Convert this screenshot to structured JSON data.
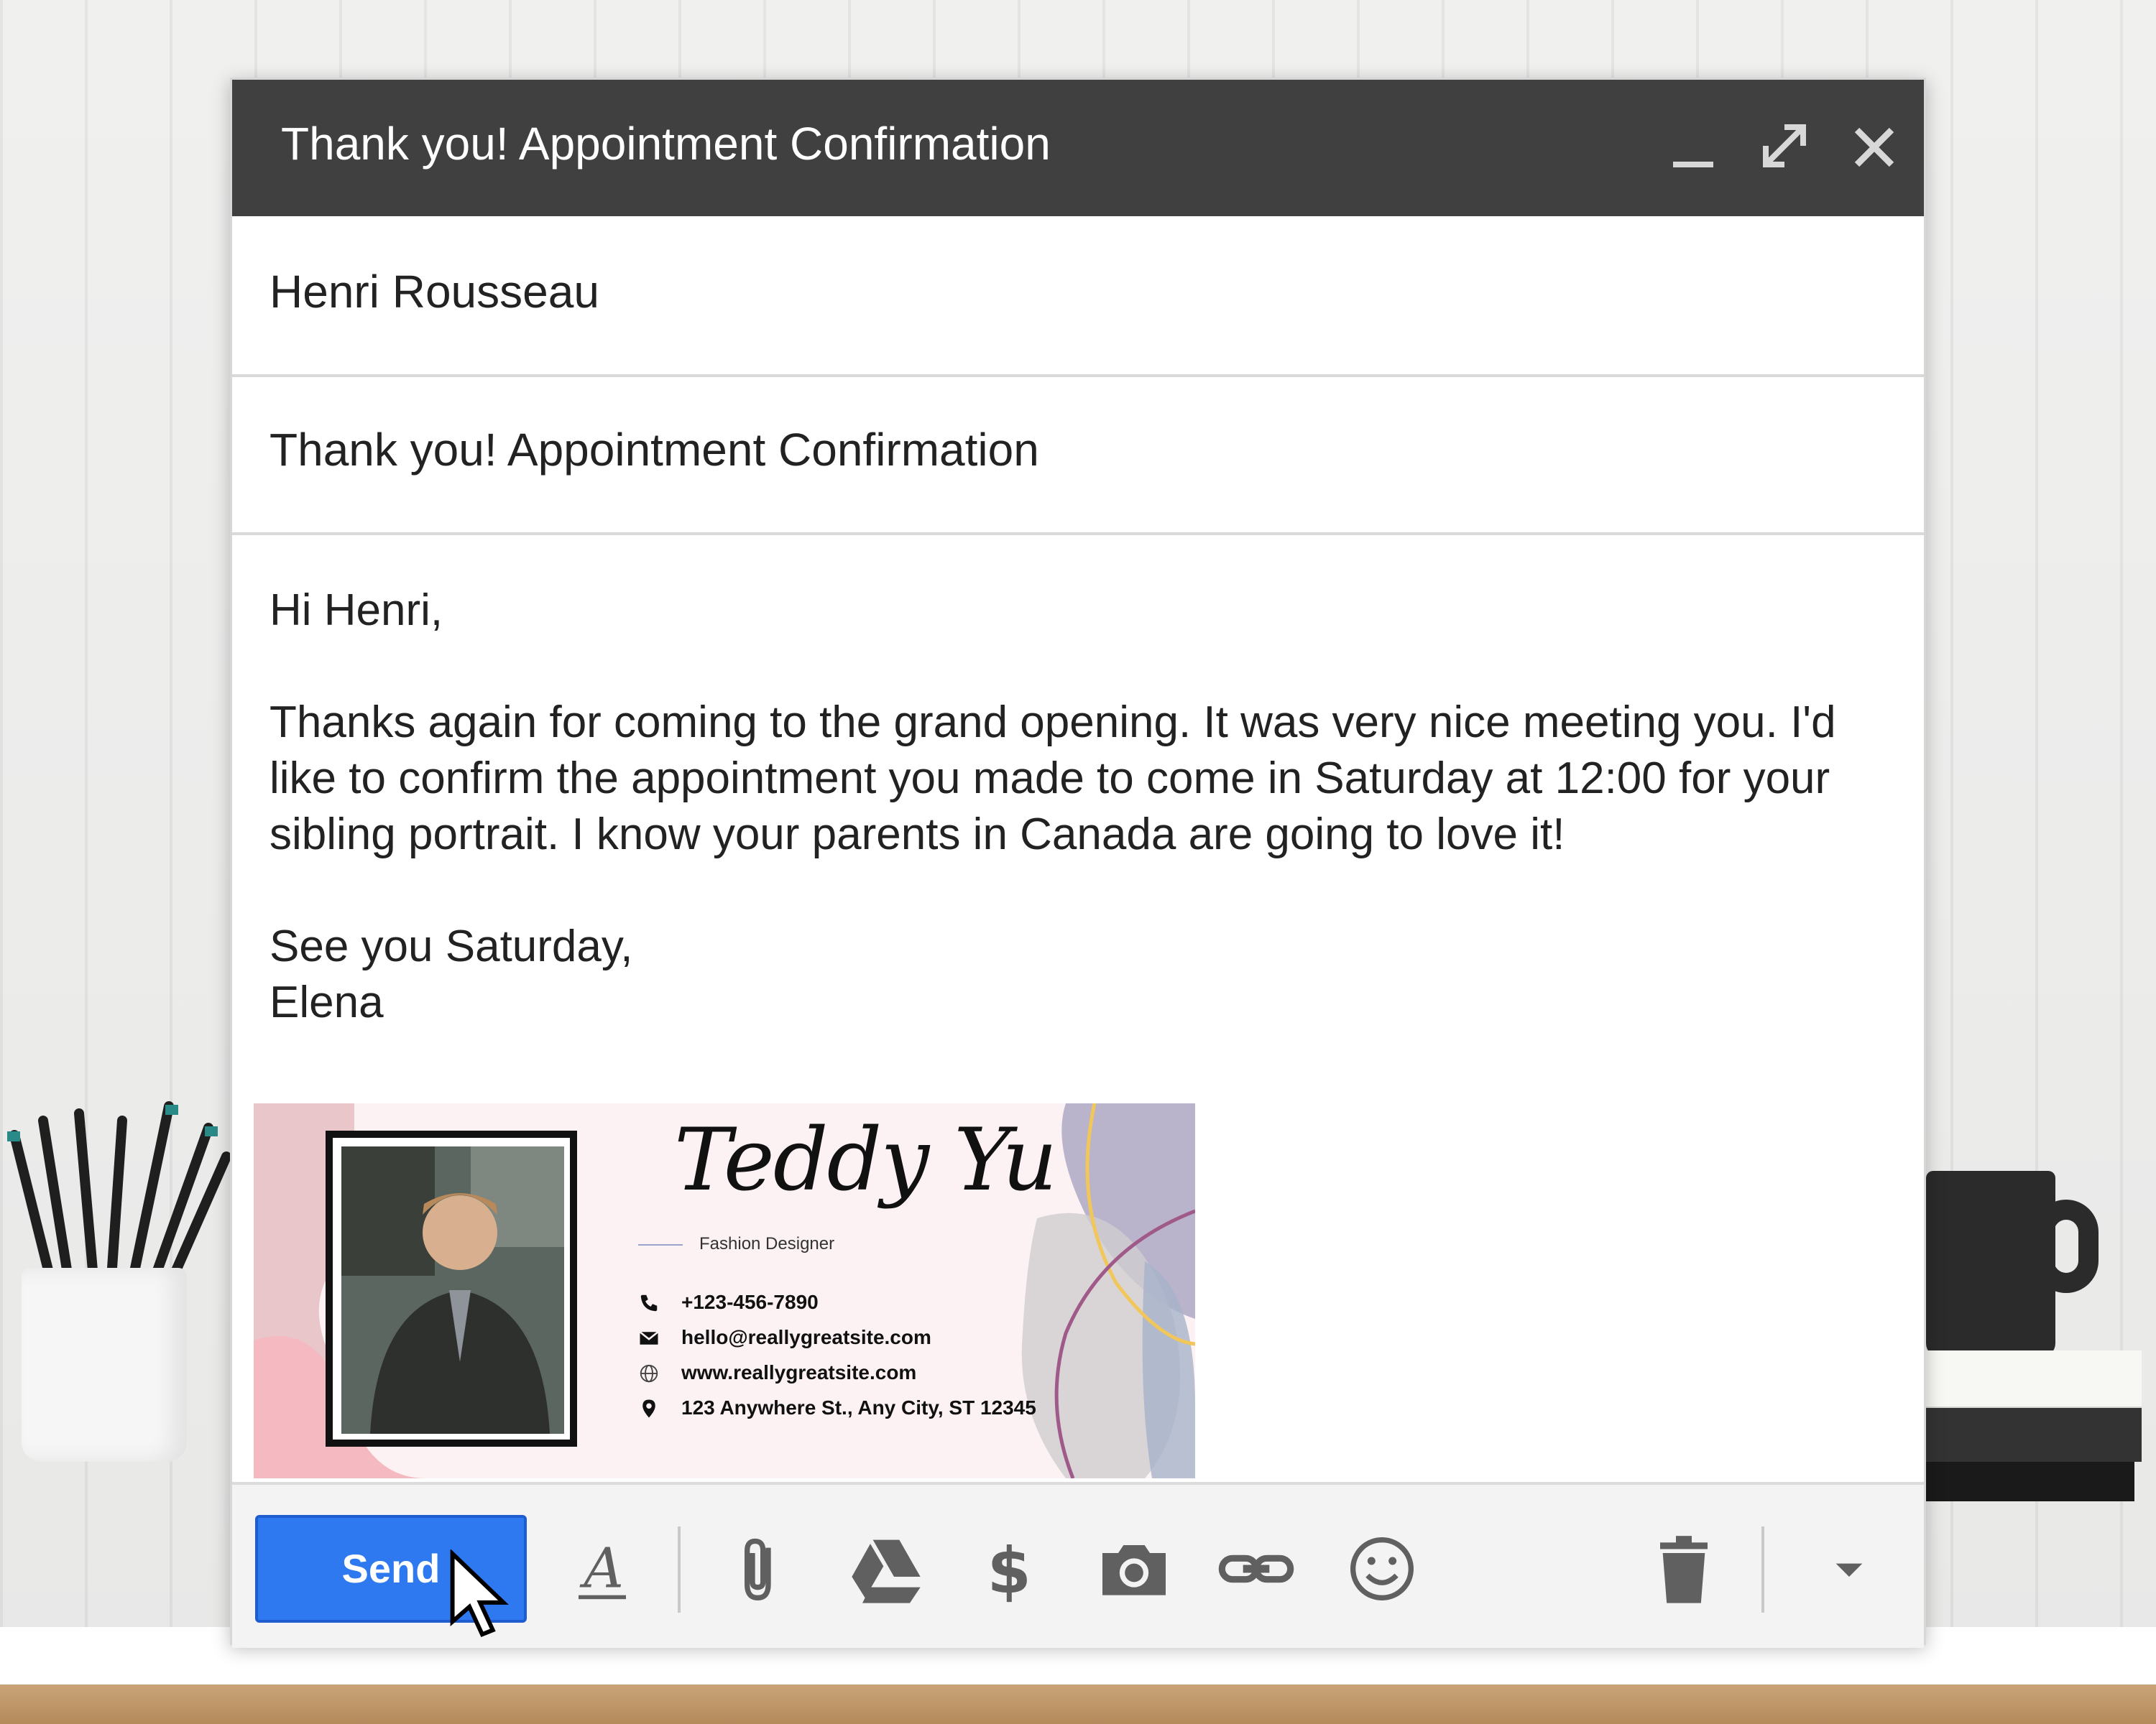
{
  "window": {
    "title": "Thank you! Appointment Confirmation",
    "controls": {
      "minimize": "minimize-icon",
      "expand": "expand-icon",
      "close": "close-icon"
    }
  },
  "compose": {
    "to": "Henri Rousseau",
    "subject": "Thank you! Appointment Confirmation",
    "body": {
      "greeting": "Hi Henri,",
      "paragraph": "Thanks again for coming to the grand opening. It was very nice meeting you. I'd like to confirm the appointment you made to come in Saturday at 12:00 for your sibling portrait. I know your parents in Canada are going to love it!",
      "closing": "See you Saturday,",
      "sender": "Elena"
    }
  },
  "signature": {
    "name": "Teddy Yu",
    "role": "Fashion Designer",
    "phone": "+123-456-7890",
    "email": "hello@reallygreatsite.com",
    "website": "www.reallygreatsite.com",
    "address": "123 Anywhere St., Any City, ST 12345"
  },
  "toolbar": {
    "send_label": "Send",
    "icons": [
      "format-text-icon",
      "attach-icon",
      "drive-icon",
      "dollar-icon",
      "camera-icon",
      "link-icon",
      "emoji-icon",
      "trash-icon",
      "more-options-icon"
    ]
  },
  "colors": {
    "titlebar": "#404040",
    "send_button": "#2e78f0"
  }
}
